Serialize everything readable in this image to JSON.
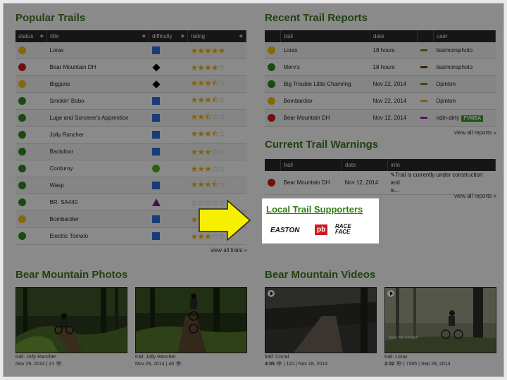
{
  "popular_trails": {
    "title": "Popular Trails",
    "headers": {
      "status": "status",
      "title": "title",
      "difficulty": "difficulty",
      "rating": "rating"
    },
    "rows": [
      {
        "status": "yellow",
        "name": "Lorax",
        "difficulty": "blue-square",
        "rating": 5
      },
      {
        "status": "red",
        "name": "Bear Mountain DH",
        "difficulty": "black-diamond",
        "rating": 4
      },
      {
        "status": "yellow",
        "name": "Bigguns",
        "difficulty": "black-diamond",
        "rating": 3.5
      },
      {
        "status": "green",
        "name": "Smokin' Bobo",
        "difficulty": "blue-square",
        "rating": 3.5
      },
      {
        "status": "green",
        "name": "Luge and Sorcerer's Apprentice",
        "difficulty": "blue-square",
        "rating": 2.5
      },
      {
        "status": "green",
        "name": "Jolly Rancher",
        "difficulty": "blue-square",
        "rating": 3.5
      },
      {
        "status": "green",
        "name": "Backdoor",
        "difficulty": "blue-square",
        "rating": 3
      },
      {
        "status": "green",
        "name": "Corduroy",
        "difficulty": "green-circle",
        "rating": 3
      },
      {
        "status": "green",
        "name": "Wasp",
        "difficulty": "blue-square",
        "rating": 3.5
      },
      {
        "status": "green",
        "name": "BR. SA440",
        "difficulty": "purple-triangle",
        "rating": 0
      },
      {
        "status": "yellow",
        "name": "Bombardier",
        "difficulty": "blue-square",
        "rating": 2
      },
      {
        "status": "green",
        "name": "Electric Tomato",
        "difficulty": "blue-square",
        "rating": 3
      }
    ],
    "view_all": "view all trails »"
  },
  "recent_reports": {
    "title": "Recent Trail Reports",
    "headers": {
      "trail": "trail",
      "date": "date",
      "user": "user"
    },
    "rows": [
      {
        "status": "yellow",
        "trail": "Lorax",
        "date": "18 hours",
        "swatch": "#4f9a1f",
        "user": "lissimorephoto",
        "badge": ""
      },
      {
        "status": "green",
        "trail": "Merv's",
        "date": "18 hours",
        "swatch": "#6b3f1a",
        "user": "lissimorephoto",
        "badge": ""
      },
      {
        "status": "green",
        "trail": "Big Trouble Little Chainring",
        "date": "Nov 22, 2014",
        "swatch": "#4f9a1f",
        "user": "Dpinton",
        "badge": ""
      },
      {
        "status": "yellow",
        "trail": "Bombardier",
        "date": "Nov 22, 2014",
        "swatch": "#e9b21a",
        "user": "Dpinton",
        "badge": ""
      },
      {
        "status": "red",
        "trail": "Bear Mountain DH",
        "date": "Nov 12, 2014",
        "swatch": "#b51fb5",
        "user": "ridin-dirty",
        "badge": "FVMBA"
      }
    ],
    "view_all": "view all reports »"
  },
  "warnings": {
    "title": "Current Trail Warnings",
    "headers": {
      "trail": "trail",
      "date": "date",
      "info": "info"
    },
    "rows": [
      {
        "status": "red",
        "trail": "Bear Mountain DH",
        "date": "Nov 12, 2014",
        "info_line1": "Trail is currently under construction and",
        "info_line2": "is..."
      }
    ],
    "view_all": "view all reports »"
  },
  "supporters": {
    "title": "Local Trail Supporters",
    "logos": [
      "EASTON",
      "pb",
      "RACE FACE"
    ]
  },
  "photos": {
    "title": "Bear Mountain Photos",
    "items": [
      {
        "trail": "trail: Jolly Rancher",
        "meta": "Nov 29, 2014 | 41"
      },
      {
        "trail": "trail: Jolly Rancher",
        "meta": "Nov 29, 2014 | 40"
      }
    ]
  },
  "videos": {
    "title": "Bear Mountain Videos",
    "items": [
      {
        "trail": "trail: Corral",
        "duration": "4:05",
        "meta": "| 110 | Nov 18, 2014"
      },
      {
        "trail": "trail: Lorax",
        "duration": "2:32",
        "meta": "| 7365 | Sep 28, 2014",
        "credit": "Ryan Van Kampen"
      }
    ]
  },
  "colors": {
    "accent_green": "#3e7a20",
    "arrow_yellow": "#f6f000",
    "status_green": "#2f8a1f",
    "status_yellow": "#f2c20f",
    "status_red": "#cf1d1d"
  }
}
